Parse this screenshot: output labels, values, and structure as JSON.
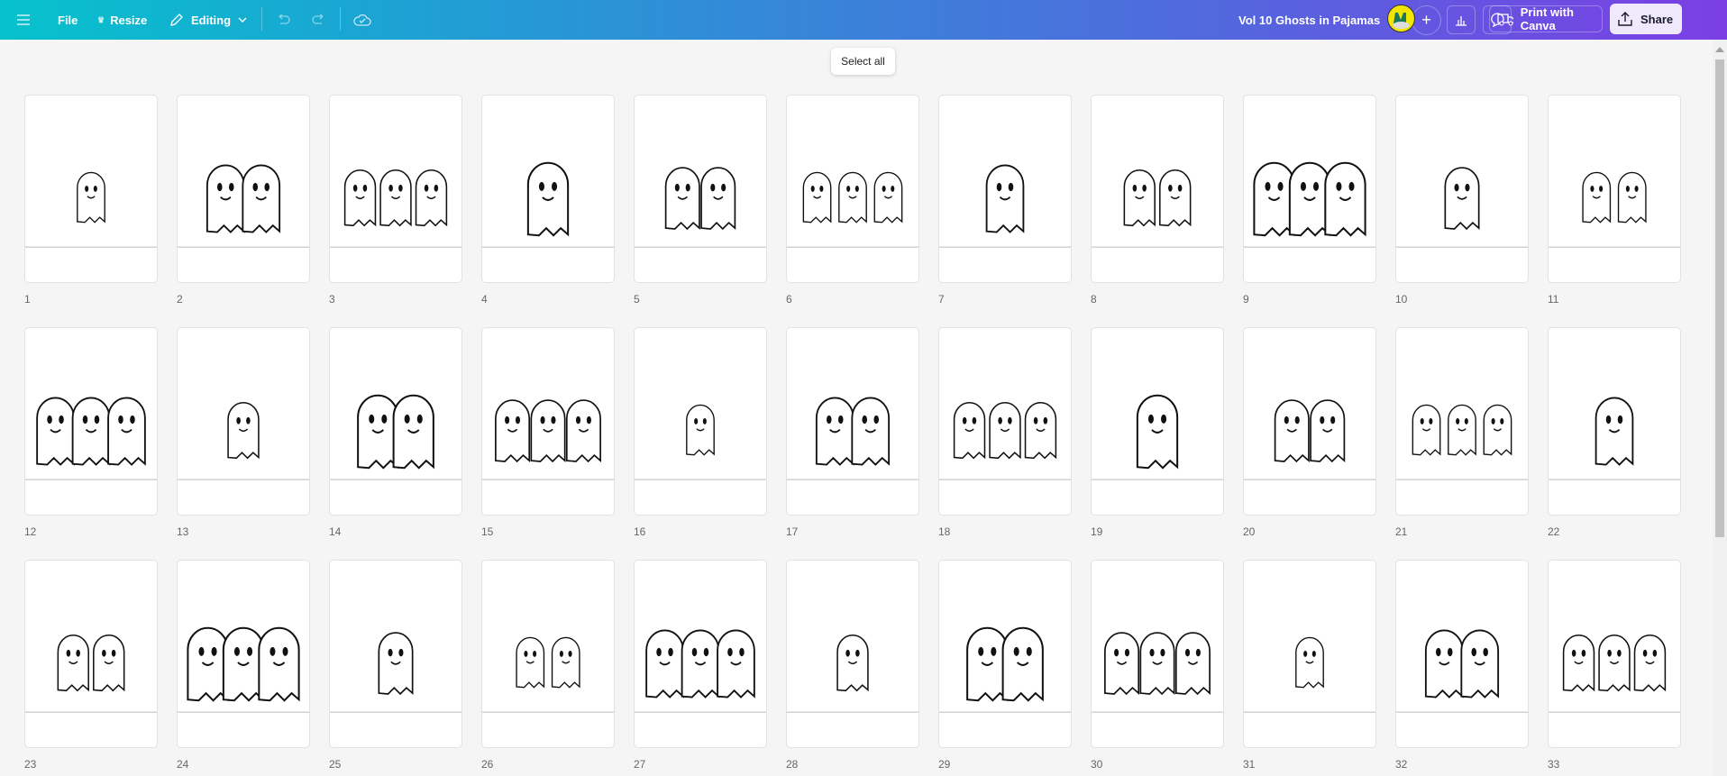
{
  "topbar": {
    "menu_icon": "hamburger-icon",
    "file_label": "File",
    "resize_label": "Resize",
    "editing_label": "Editing",
    "title": "Vol 10 Ghosts in Pajamas",
    "print_label": "Print with Canva",
    "share_label": "Share",
    "plus_label": "+"
  },
  "tooltip": "Select all",
  "colors": {
    "gradient_start": "#06c2cc",
    "gradient_end": "#7b3fe4"
  },
  "pages": [
    "1",
    "2",
    "3",
    "4",
    "5",
    "6",
    "7",
    "8",
    "9",
    "10",
    "11",
    "12",
    "13",
    "14",
    "15",
    "16",
    "17",
    "18",
    "19",
    "20",
    "21",
    "22",
    "23",
    "24",
    "25",
    "26",
    "27",
    "28",
    "29",
    "30",
    "31",
    "32",
    "33"
  ]
}
